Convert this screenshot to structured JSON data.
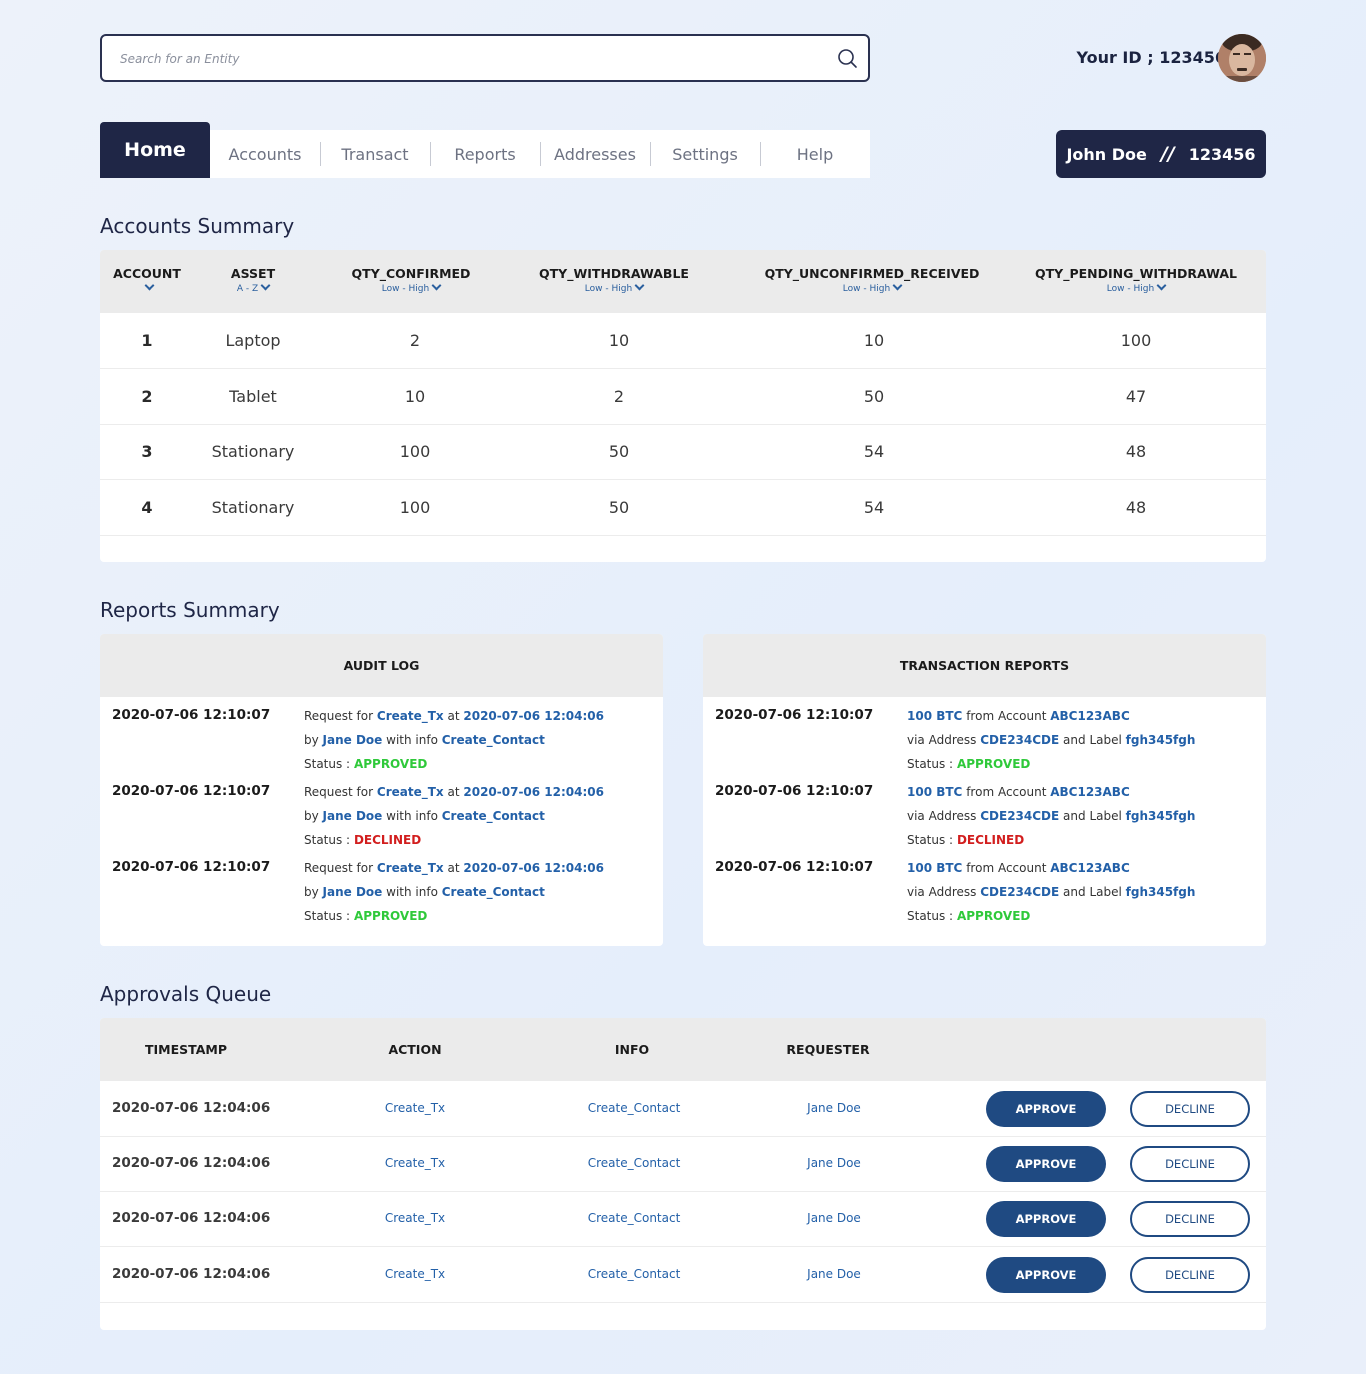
{
  "search": {
    "placeholder": "Search for an Entity",
    "icon": "search-icon"
  },
  "user": {
    "id_label": "Your ID ; 123456",
    "name": "John Doe",
    "separator": "//",
    "id": "123456"
  },
  "nav": {
    "home": "Home",
    "items": [
      "Accounts",
      "Transact",
      "Reports",
      "Addresses",
      "Settings",
      "Help"
    ]
  },
  "accounts_summary": {
    "title": "Accounts Summary",
    "columns": [
      {
        "label": "ACCOUNT",
        "sort": ""
      },
      {
        "label": "ASSET",
        "sort": "A - Z"
      },
      {
        "label": "QTY_CONFIRMED",
        "sort": "Low - High"
      },
      {
        "label": "QTY_WITHDRAWABLE",
        "sort": "Low - High"
      },
      {
        "label": "QTY_UNCONFIRMED_RECEIVED",
        "sort": "Low - High"
      },
      {
        "label": "QTY_PENDING_WITHDRAWAL",
        "sort": "Low - High"
      }
    ],
    "rows": [
      [
        "1",
        "Laptop",
        "2",
        "10",
        "10",
        "100"
      ],
      [
        "2",
        "Tablet",
        "10",
        "2",
        "50",
        "47"
      ],
      [
        "3",
        "Stationary",
        "100",
        "50",
        "54",
        "48"
      ],
      [
        "4",
        "Stationary",
        "100",
        "50",
        "54",
        "48"
      ]
    ]
  },
  "reports_summary": {
    "title": "Reports Summary",
    "audit_log": {
      "header": "AUDIT LOG",
      "entries": [
        {
          "timestamp": "2020-07-06  12:10:07",
          "w1": "Request for",
          "action": "Create_Tx",
          "w2": "at",
          "at": "2020-07-06  12:04:06",
          "w3": "by",
          "by": "Jane Doe",
          "w4": "with info",
          "info": "Create_Contact",
          "status_label": "Status :",
          "status": "APPROVED"
        },
        {
          "timestamp": "2020-07-06  12:10:07",
          "w1": "Request for",
          "action": "Create_Tx",
          "w2": "at",
          "at": "2020-07-06  12:04:06",
          "w3": "by",
          "by": "Jane Doe",
          "w4": "with info",
          "info": "Create_Contact",
          "status_label": "Status :",
          "status": "DECLINED"
        },
        {
          "timestamp": "2020-07-06  12:10:07",
          "w1": "Request for",
          "action": "Create_Tx",
          "w2": "at",
          "at": "2020-07-06  12:04:06",
          "w3": "by",
          "by": "Jane Doe",
          "w4": "with info",
          "info": "Create_Contact",
          "status_label": "Status :",
          "status": "APPROVED"
        }
      ]
    },
    "transaction_reports": {
      "header": "TRANSACTION REPORTS",
      "entries": [
        {
          "timestamp": "2020-07-06  12:10:07",
          "amount": "100 BTC",
          "w1": "from Account",
          "account": "ABC123ABC",
          "w2": "via Address",
          "address": "CDE234CDE",
          "w3": "and Label",
          "label": "fgh345fgh",
          "status_label": "Status :",
          "status": "APPROVED"
        },
        {
          "timestamp": "2020-07-06  12:10:07",
          "amount": "100 BTC",
          "w1": "from Account",
          "account": "ABC123ABC",
          "w2": "via Address",
          "address": "CDE234CDE",
          "w3": "and Label",
          "label": "fgh345fgh",
          "status_label": "Status :",
          "status": "DECLINED"
        },
        {
          "timestamp": "2020-07-06  12:10:07",
          "amount": "100 BTC",
          "w1": "from Account",
          "account": "ABC123ABC",
          "w2": "via Address",
          "address": "CDE234CDE",
          "w3": "and Label",
          "label": "fgh345fgh",
          "status_label": "Status :",
          "status": "APPROVED"
        }
      ]
    }
  },
  "approvals_queue": {
    "title": "Approvals Queue",
    "columns": [
      "TIMESTAMP",
      "ACTION",
      "INFO",
      "REQUESTER"
    ],
    "approve_label": "APPROVE",
    "decline_label": "DECLINE",
    "rows": [
      {
        "timestamp": "2020-07-06  12:04:06",
        "action": "Create_Tx",
        "info": "Create_Contact",
        "requester": "Jane Doe"
      },
      {
        "timestamp": "2020-07-06  12:04:06",
        "action": "Create_Tx",
        "info": "Create_Contact",
        "requester": "Jane Doe"
      },
      {
        "timestamp": "2020-07-06  12:04:06",
        "action": "Create_Tx",
        "info": "Create_Contact",
        "requester": "Jane Doe"
      },
      {
        "timestamp": "2020-07-06  12:04:06",
        "action": "Create_Tx",
        "info": "Create_Contact",
        "requester": "Jane Doe"
      }
    ]
  },
  "colors": {
    "primary": "#1f2646",
    "link": "#2360a8",
    "approved": "#2fc93a",
    "declined": "#d21e1e",
    "button": "#1f4a82"
  }
}
